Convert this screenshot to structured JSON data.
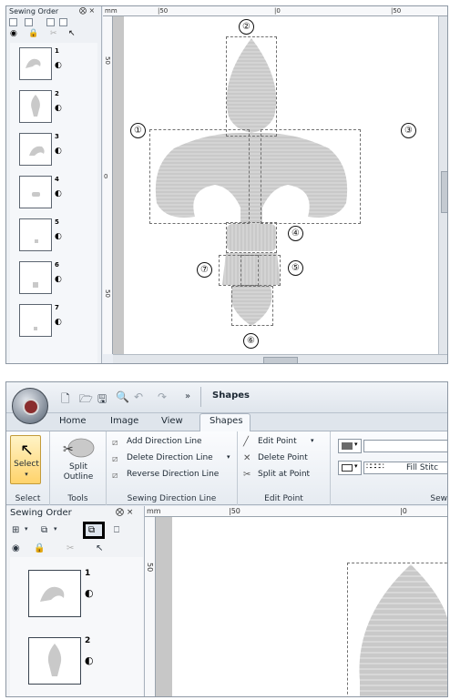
{
  "top": {
    "panel_title": "Sewing Order",
    "panel_controls": "⨂ ×",
    "thumbnails": [
      {
        "number": "1"
      },
      {
        "number": "2"
      },
      {
        "number": "3"
      },
      {
        "number": "4"
      },
      {
        "number": "5"
      },
      {
        "number": "6"
      },
      {
        "number": "7"
      }
    ],
    "ruler_h": [
      "mm",
      "|50",
      "|0",
      "|50"
    ],
    "ruler_v": [
      "50",
      "0",
      "50"
    ],
    "callouts": [
      "①",
      "②",
      "③",
      "④",
      "⑤",
      "⑥",
      "⑦"
    ]
  },
  "bottom": {
    "qat_title": "Shapes",
    "qat_chevron": "»",
    "tabs": [
      "Home",
      "Image",
      "View",
      "Shapes"
    ],
    "active_tab": "Shapes",
    "ribbon": {
      "select": {
        "label": "Select",
        "group": "Select"
      },
      "tools": {
        "label_line1": "Split",
        "label_line2": "Outline",
        "group": "Tools"
      },
      "direction": {
        "add": "Add Direction Line",
        "delete": "Delete Direction Line",
        "reverse": "Reverse Direction Line",
        "group": "Sewing Direction Line"
      },
      "edit": {
        "edit_point": "Edit Point",
        "delete_point": "Delete Point",
        "split_point": "Split at Point",
        "group": "Edit Point"
      },
      "sew": {
        "fill_stitch": "Fill Stitc",
        "group": "Sew"
      }
    },
    "sidepanel": {
      "title": "Sewing Order",
      "controls": "⨂ ×",
      "thumbnails": [
        {
          "number": "1"
        },
        {
          "number": "2"
        }
      ]
    },
    "ruler_h": [
      "mm",
      "|50",
      "|0"
    ],
    "ruler_v": [
      "50"
    ]
  },
  "colors": {
    "shape_fill": "#c9c9c9",
    "stitch_line": "#e6e6e6",
    "highlight_border": "#000000"
  }
}
